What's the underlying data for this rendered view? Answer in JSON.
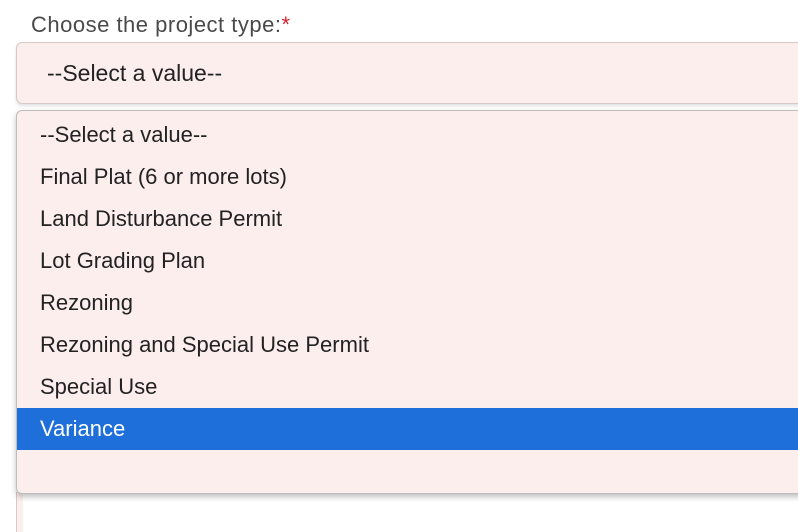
{
  "field": {
    "label": "Choose the project type:",
    "required_marker": "*",
    "selected_value": "--Select a value--"
  },
  "dropdown": {
    "options": [
      "--Select a value--",
      "Final Plat (6 or more lots)",
      "Land Disturbance Permit",
      "Lot Grading Plan",
      "Rezoning",
      "Rezoning and Special Use Permit",
      "Special Use",
      "Variance"
    ],
    "highlighted_option": "Variance"
  },
  "colors": {
    "field_background": "#fdeeee",
    "highlight": "#1e6fd9",
    "required_marker": "#d9232d"
  }
}
